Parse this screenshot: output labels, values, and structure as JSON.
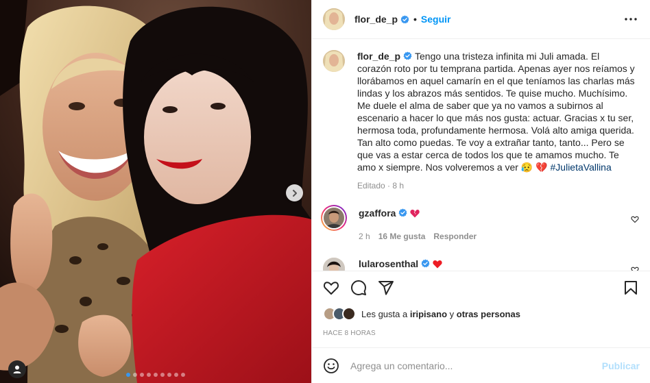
{
  "colors": {
    "accent": "#0095f6",
    "verified": "#3897f0",
    "muted": "#8e8e8e",
    "heart_red": "#ed4956",
    "publish_disabled": "#b2dffc"
  },
  "carousel": {
    "total": 9,
    "active_index": 0
  },
  "header": {
    "username": "flor_de_p",
    "separator": "•",
    "follow_label": "Seguir"
  },
  "caption": {
    "username": "flor_de_p",
    "text": "Tengo una tristeza infinita mi Juli amada. El corazón roto por tu temprana partida. Apenas ayer nos reíamos y llorábamos en aquel camarín en el que teníamos las charlas más lindas y los abrazos más sentidos. Te quise mucho. Muchísimo. Me duele el alma de saber que ya no vamos a subirnos al escenario a hacer lo que más nos gusta: actuar. Gracias x tu ser, hermosa toda, profundamente hermosa. Volá alto amiga querida. Tan alto como puedas. Te voy a extrañar tanto, tanto... Pero se que vas a estar cerca de todos los que te amamos mucho. Te amo x siempre. Nos volveremos a ver ",
    "emojis": "😥 💔",
    "hashtag": "#JulietaVallina",
    "meta": "Editado · 8 h"
  },
  "comments": [
    {
      "username": "gzaffora",
      "emoji": "broken-heart",
      "time": "2 h",
      "likes": "16 Me gusta",
      "reply_label": "Responder"
    },
    {
      "username": "lularosenthal",
      "emoji": "red-heart"
    }
  ],
  "likes": {
    "prefix": "Les gusta a ",
    "user": "iripisano",
    "middle": " y ",
    "others": "otras personas"
  },
  "time_ago": "HACE 8 HORAS",
  "add_comment": {
    "placeholder": "Agrega un comentario...",
    "publish_label": "Publicar"
  }
}
